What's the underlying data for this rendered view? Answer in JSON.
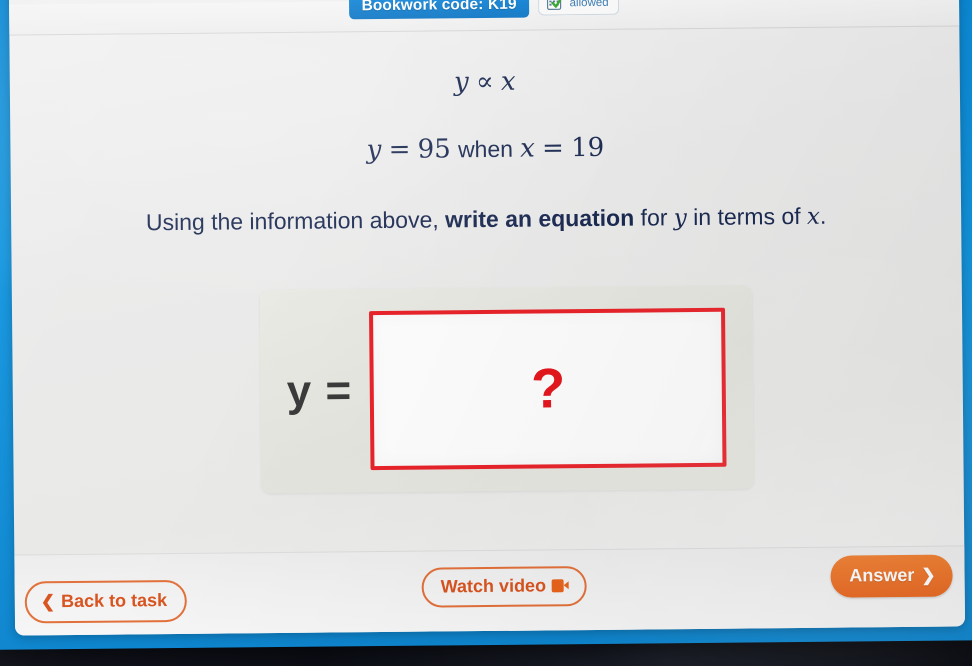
{
  "header": {
    "bookwork_badge": "Bookwork code: K19",
    "calculator_badge": {
      "label": "allowed",
      "icon": "calculator-check-icon"
    }
  },
  "question": {
    "relation": {
      "lhs": "y",
      "symbol": "∝",
      "rhs": "x"
    },
    "given": {
      "y_label": "y",
      "eq1": "=",
      "y_value": "95",
      "connector": "when",
      "x_label": "x",
      "eq2": "=",
      "x_value": "19"
    },
    "prompt": {
      "part1": "Using the information above, ",
      "bold": "write an equation",
      "part2": " for ",
      "var_y": "y",
      "part3": " in terms of ",
      "var_x": "x",
      "part4": "."
    }
  },
  "answer_area": {
    "y_equals": "y =",
    "input_value": "",
    "placeholder": "?",
    "border_color": "#e8232a"
  },
  "footer": {
    "back_button": {
      "label": "Back to task",
      "icon": "chevron-left-icon"
    },
    "video_button": {
      "label": "Watch video",
      "icon": "video-camera-icon"
    },
    "answer_button": {
      "label": "Answer",
      "icon": "chevron-right-icon"
    }
  },
  "colors": {
    "accent_blue": "#1b8fe0",
    "accent_orange": "#e8641c",
    "answer_red": "#e8232a",
    "text_navy": "#1b2a52"
  }
}
